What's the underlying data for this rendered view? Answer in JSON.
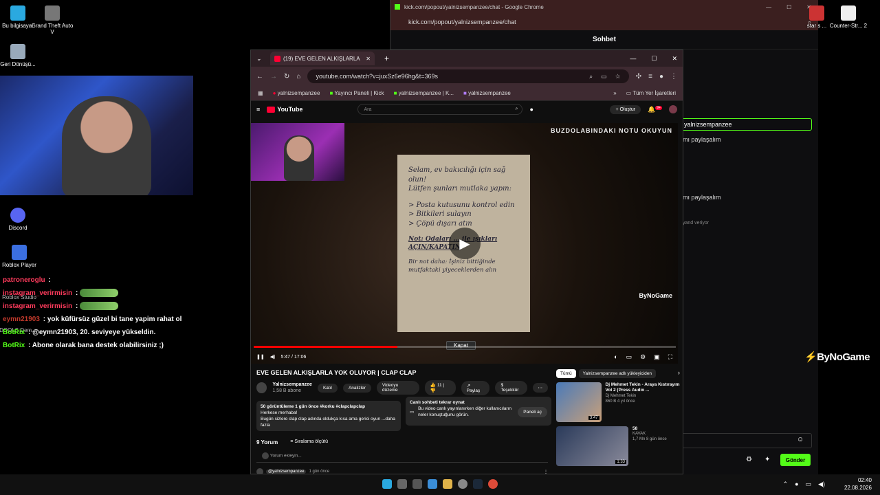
{
  "desktop": {
    "icons_left": [
      {
        "label": "Bu bilgisayar",
        "color": "#2aa9e0"
      },
      {
        "label": "Grand Theft Auto V",
        "color": "#777"
      },
      {
        "label": "Geri Dönüşü...",
        "color": "#9ab"
      },
      {
        "label": "Discord",
        "color": "#5865f2"
      },
      {
        "label": "Roblox Player",
        "color": "#3b6fe0"
      },
      {
        "label": "Roblox Studio",
        "color": "#3b6fe0"
      },
      {
        "label": "DOOLS Dem...",
        "color": "#666"
      }
    ],
    "icons_right": [
      {
        "label": "star s ...",
        "color": "#c33"
      },
      {
        "label": "Counter-Str... 2",
        "color": "#eee"
      }
    ]
  },
  "stream_chat": [
    {
      "user": "patroneroglu",
      "user_color": "#ff3b5c",
      "text": ":",
      "emote": false
    },
    {
      "user": "instagram_verirmisin",
      "user_color": "#ff3b5c",
      "text": ":",
      "emote": true
    },
    {
      "user": "instagram_verirmisin",
      "user_color": "#ff3b5c",
      "text": ":",
      "emote": true
    },
    {
      "user": "eymn21903",
      "user_color": "#c0392b",
      "text": ": yok küfürsüz güzel bi tane yapim rahat ol",
      "emote": false
    },
    {
      "user": "BotRix",
      "user_color": "#53fc18",
      "text": ": @eymn21903, 20. seviyeye yükseldin.",
      "emote": false
    },
    {
      "user": "BotRix",
      "user_color": "#53fc18",
      "text": ": Abone olarak bana destek olabilirsiniz ;)",
      "emote": false
    }
  ],
  "kick_window": {
    "title": "kick.com/popout/yalnizsempanzee/chat - Google Chrome",
    "url": "kick.com/popout/yalnizsempanzee/chat",
    "header": "Sohbet",
    "highlighted_user": "yalnizsempanzee",
    "messages": [
      "mı paylaşalım",
      "mı paylaşalım",
      "yand veriyor"
    ],
    "send_label": "Gönder"
  },
  "youtube_window": {
    "tab_title": "(19) EVE GELEN ALKIŞLARLA",
    "url": "youtube.com/watch?v=juxSz6e96hg&t=369s",
    "bookmarks": [
      "yalnizsempanzee",
      "Yayıncı Paneli | Kick",
      "yalnizsempanzee | K...",
      "yalnizsempanzee"
    ],
    "all_bookmarks": "Tüm Yer İşaretleri",
    "logo": "YouTube",
    "search_placeholder": "Ara",
    "create_label": "Oluştur",
    "notif_count": "9+"
  },
  "player": {
    "overlay_text": "BUZDOLABINDAKI NOTU OKUYUN",
    "note_lines": [
      "Selam, ev bakıcılığı için sağ olun!",
      "Lütfen şunları mutlaka yapın:"
    ],
    "note_list": [
      "> Posta kutusunu kontrol edin",
      "> Bitkileri sulayın",
      "> Çöpü dışarı atın"
    ],
    "note_warn": "Not: Odaları ... ile ışıkları AÇIN/KAPATIN",
    "note_end": "Bir not daha: İşiniz bittiğinde mutfaktaki yiyeceklerden alın",
    "close_label": "Kapat",
    "watermark": "ByNoGame",
    "time": "5:47 / 17:06",
    "progress": 0.34
  },
  "video": {
    "title": "EVE GELEN ALKIŞLARLA YOK OLUYOR | CLAP CLAP",
    "channel": "Yalnizsempanzee",
    "subs": "1,58 B abone",
    "join": "Katıl",
    "analytics": "Analizler",
    "edit": "Videoyu düzenle",
    "likes": "11",
    "share": "Paylaş",
    "thanks": "Teşekkür",
    "desc_stats": "50 görüntüleme  1 gün önce  #korku #clapclapclap",
    "desc_line1": "Herkese merhaba!",
    "desc_line2": "Bugün sizlere clap clap adında oldukça kısa ama gerici oyun ...daha fazla",
    "live_chat_title": "Canlı sohbeti tekrar oynat",
    "live_chat_text": "Bu video canlı yayınlanırken diğer kullanıcıların neler konuştuğunu görün.",
    "live_chat_btn": "Paneli aç",
    "comment_count": "9 Yorum",
    "sort_label": "Sıralama ölçütü",
    "add_comment": "Yorum ekleyin...",
    "first_comment_user": "@yalnizsempanzee",
    "first_comment_time": "1 gün önce"
  },
  "recommendations": {
    "chips": [
      "Tümü",
      "Yalnizsempanzee adlı yükleyiciden"
    ],
    "items": [
      {
        "title": "Dj Mehmet Tekin - Araya Kıstırayım Vol 2 (Press Audio ...",
        "channel": "Dj Mehmet Tekin",
        "stats": "860 B  4 yıl önce",
        "duration": "3:47",
        "color": "#4a7ab8"
      },
      {
        "title": "58",
        "channel": "KAVAK",
        "stats": "1,7 Mn  8 gün önce",
        "duration": "1:33",
        "color": "#2a3a5a"
      }
    ]
  },
  "overlay_logo": "ByNoGame",
  "taskbar": {
    "time": "02:40",
    "date": "22.08.2026"
  }
}
